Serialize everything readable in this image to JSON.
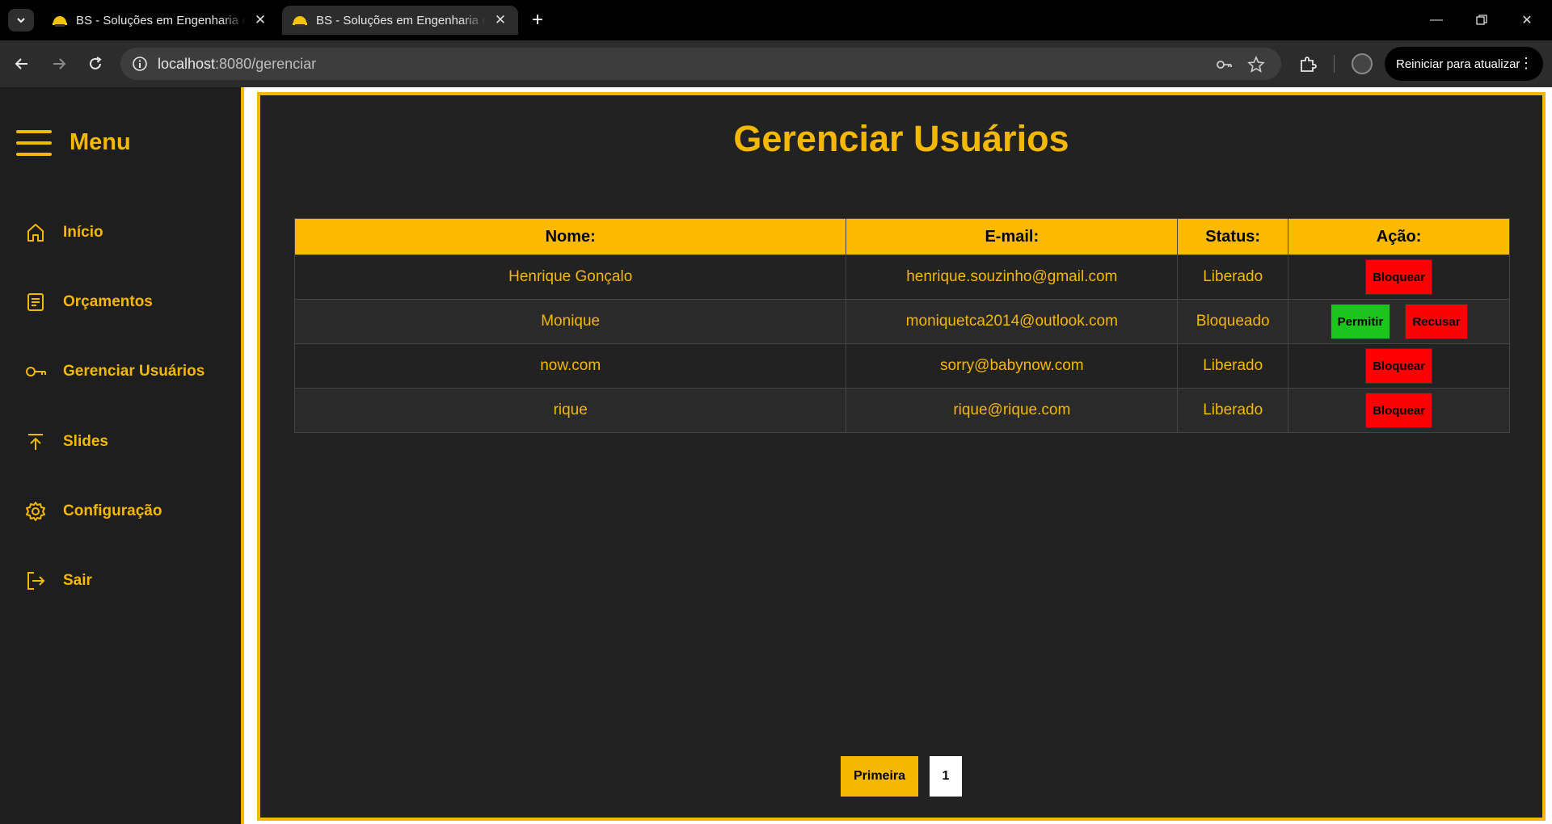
{
  "browser": {
    "tabs": [
      {
        "title": "BS - Soluções em Engenharia e",
        "active": false
      },
      {
        "title": "BS - Soluções em Engenharia e",
        "active": true
      }
    ],
    "url_host": "localhost",
    "url_path": ":8080/gerenciar",
    "update_button": "Reiniciar para atualizar"
  },
  "sidebar": {
    "title": "Menu",
    "items": [
      {
        "label": "Início",
        "icon": "home-icon"
      },
      {
        "label": "Orçamentos",
        "icon": "document-icon"
      },
      {
        "label": "Gerenciar Usuários",
        "icon": "key-icon"
      },
      {
        "label": "Slides",
        "icon": "upload-icon"
      },
      {
        "label": "Configuração",
        "icon": "gear-icon"
      },
      {
        "label": "Sair",
        "icon": "logout-icon"
      }
    ]
  },
  "main": {
    "title": "Gerenciar Usuários",
    "table": {
      "headers": [
        "Nome:",
        "E-mail:",
        "Status:",
        "Ação:"
      ],
      "rows": [
        {
          "name": "Henrique Gonçalo",
          "email": "henrique.souzinho@gmail.com",
          "status": "Liberado",
          "actions": [
            "Bloquear"
          ]
        },
        {
          "name": "Monique",
          "email": "moniquetca2014@outlook.com",
          "status": "Bloqueado",
          "actions": [
            "Permitir",
            "Recusar"
          ]
        },
        {
          "name": "now.com",
          "email": "sorry@babynow.com",
          "status": "Liberado",
          "actions": [
            "Bloquear"
          ]
        },
        {
          "name": "rique",
          "email": "rique@rique.com",
          "status": "Liberado",
          "actions": [
            "Bloquear"
          ]
        }
      ]
    },
    "pagination": {
      "first_label": "Primeira",
      "pages": [
        "1"
      ]
    }
  },
  "colors": {
    "accent": "#f5b800",
    "danger": "#ff0000",
    "success": "#1cc51c",
    "panel": "#222222"
  }
}
